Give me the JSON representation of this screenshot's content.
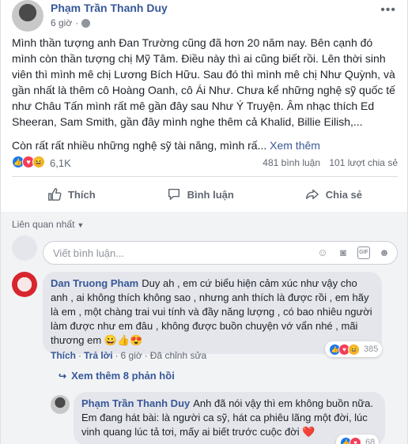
{
  "post": {
    "author": "Phạm Trần Thanh Duy",
    "time": "6 giờ",
    "paragraph1": "Mình thần tượng anh Đan Trường cũng đã hơn 20 năm nay. Bên cạnh đó mình còn thần tượng chị Mỹ Tâm. Điều này thì ai cũng biết rồi. Lên thời sinh viên thì mình mê chị Lương Bích Hữu. Sau đó thì mình mê chị Như Quỳnh, và gần nhất là thêm cô Hoàng Oanh, cô Ái Như. Chưa kể những nghệ sỹ quốc tế như Châu Tấn mình rất mê gần đây sau Như Ý Truyện. Âm nhạc thích Ed Sheeran, Sam Smith, gần đây mình nghe thêm cả Khalid, Billie Eilish,...",
    "paragraph2": "Còn rất rất nhiều những nghệ sỹ tài năng, mình rấ...",
    "see_more": "Xem thêm",
    "reactions_count": "6,1K",
    "comments_count": "481 bình luận",
    "shares_count": "101 lượt chia sẻ"
  },
  "actions": {
    "like": "Thích",
    "comment": "Bình luận",
    "share": "Chia sẻ"
  },
  "comments": {
    "sort_label": "Liên quan nhất",
    "input_placeholder": "Viết bình luận...",
    "first": {
      "author": "Dan Truong Pham",
      "text": "Duy ah , em cứ biểu hiện cảm xúc như vậy cho anh , ai không thích không sao , nhưng anh thích là được rồi , em hãy là em , một chàng trai vui tính và đầy năng lượng , có bao nhiêu người làm được như em đâu , không được buồn chuyện vớ vẩn nhé , mãi thương em 😀👍😍",
      "reaction_count": "385",
      "like_label": "Thích",
      "reply_label": "Trả lời",
      "time": "6 giờ",
      "edited_label": "Đã chỉnh sửa"
    },
    "view_more_replies": "Xem thêm 8 phản hồi",
    "reply": {
      "author": "Phạm Trần Thanh Duy",
      "text": "Anh đã nói vậy thì em không buồn nữa. Em đang hát bài: là người ca sỹ, hát ca phiêu lãng một đời, lúc vinh quang lúc tả tơi, mấy ai biết trước cuộc đời",
      "heart": "❤️",
      "reaction_count": "68"
    }
  },
  "icons": {
    "globe": "globe-icon",
    "more": "more-options-icon",
    "like": "thumbs-up-icon",
    "comment": "speech-bubble-icon",
    "share": "share-arrow-icon",
    "emoji": "emoji-icon",
    "camera": "camera-icon",
    "gif": "GIF",
    "sticker": "sticker-icon"
  },
  "colors": {
    "link": "#385898",
    "like_blue": "#1877f2",
    "love_red": "#f33e58",
    "haha_yellow": "#f7b125"
  }
}
